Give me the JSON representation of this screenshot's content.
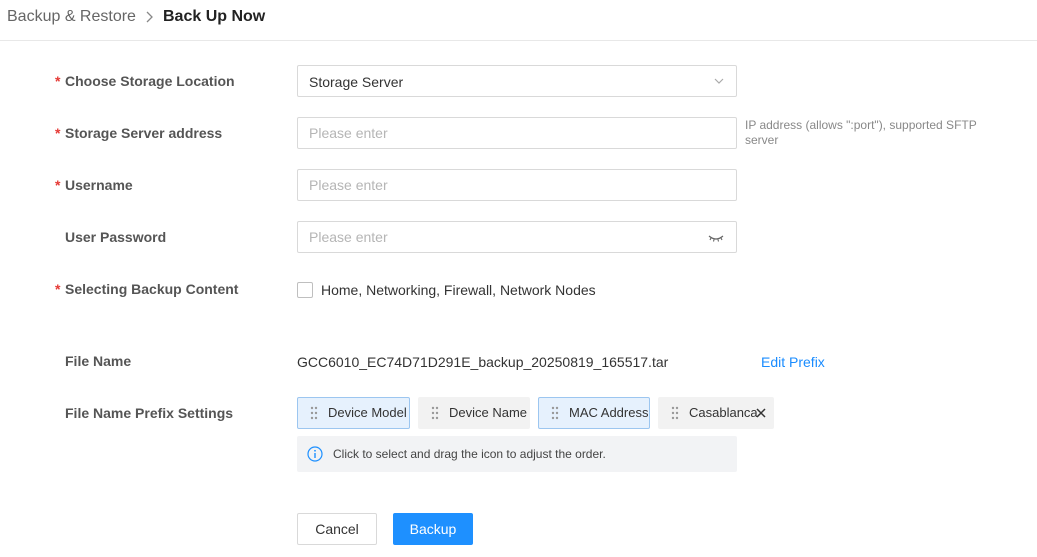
{
  "breadcrumb": {
    "parent": "Backup & Restore",
    "current": "Back Up Now"
  },
  "form": {
    "storage_location": {
      "label": "Choose Storage Location",
      "required": true,
      "value": "Storage Server"
    },
    "server_address": {
      "label": "Storage Server address",
      "required": true,
      "placeholder": "Please enter",
      "hint": "IP address (allows \":port\"), supported SFTP server"
    },
    "username": {
      "label": "Username",
      "required": true,
      "placeholder": "Please enter"
    },
    "password": {
      "label": "User Password",
      "required": false,
      "placeholder": "Please enter"
    },
    "backup_content": {
      "label": "Selecting Backup Content",
      "required": true,
      "option": "Home, Networking, Firewall, Network Nodes",
      "checked": false
    },
    "file_name": {
      "label": "File Name",
      "value": "GCC6010_EC74D71D291E_backup_20250819_165517.tar",
      "edit_link": "Edit Prefix"
    },
    "prefix_settings": {
      "label": "File Name Prefix Settings",
      "chips": [
        {
          "label": "Device Model",
          "selected": true
        },
        {
          "label": "Device Name",
          "selected": false
        },
        {
          "label": "MAC Address",
          "selected": true
        },
        {
          "label": "Casablanca",
          "selected": false,
          "removable": true
        }
      ],
      "info": "Click to select and drag the icon to adjust the order."
    }
  },
  "buttons": {
    "cancel": "Cancel",
    "backup": "Backup"
  },
  "colors": {
    "primary": "#1e90ff",
    "required": "#e53935",
    "link": "#1a8cff",
    "chip_selected_bg": "#e6f1fd",
    "chip_selected_border": "#9cc6f0"
  },
  "icons": [
    "chevron-right-icon",
    "chevron-down-icon",
    "eye-closed-icon",
    "drag-handle-icon",
    "close-icon",
    "info-icon"
  ]
}
